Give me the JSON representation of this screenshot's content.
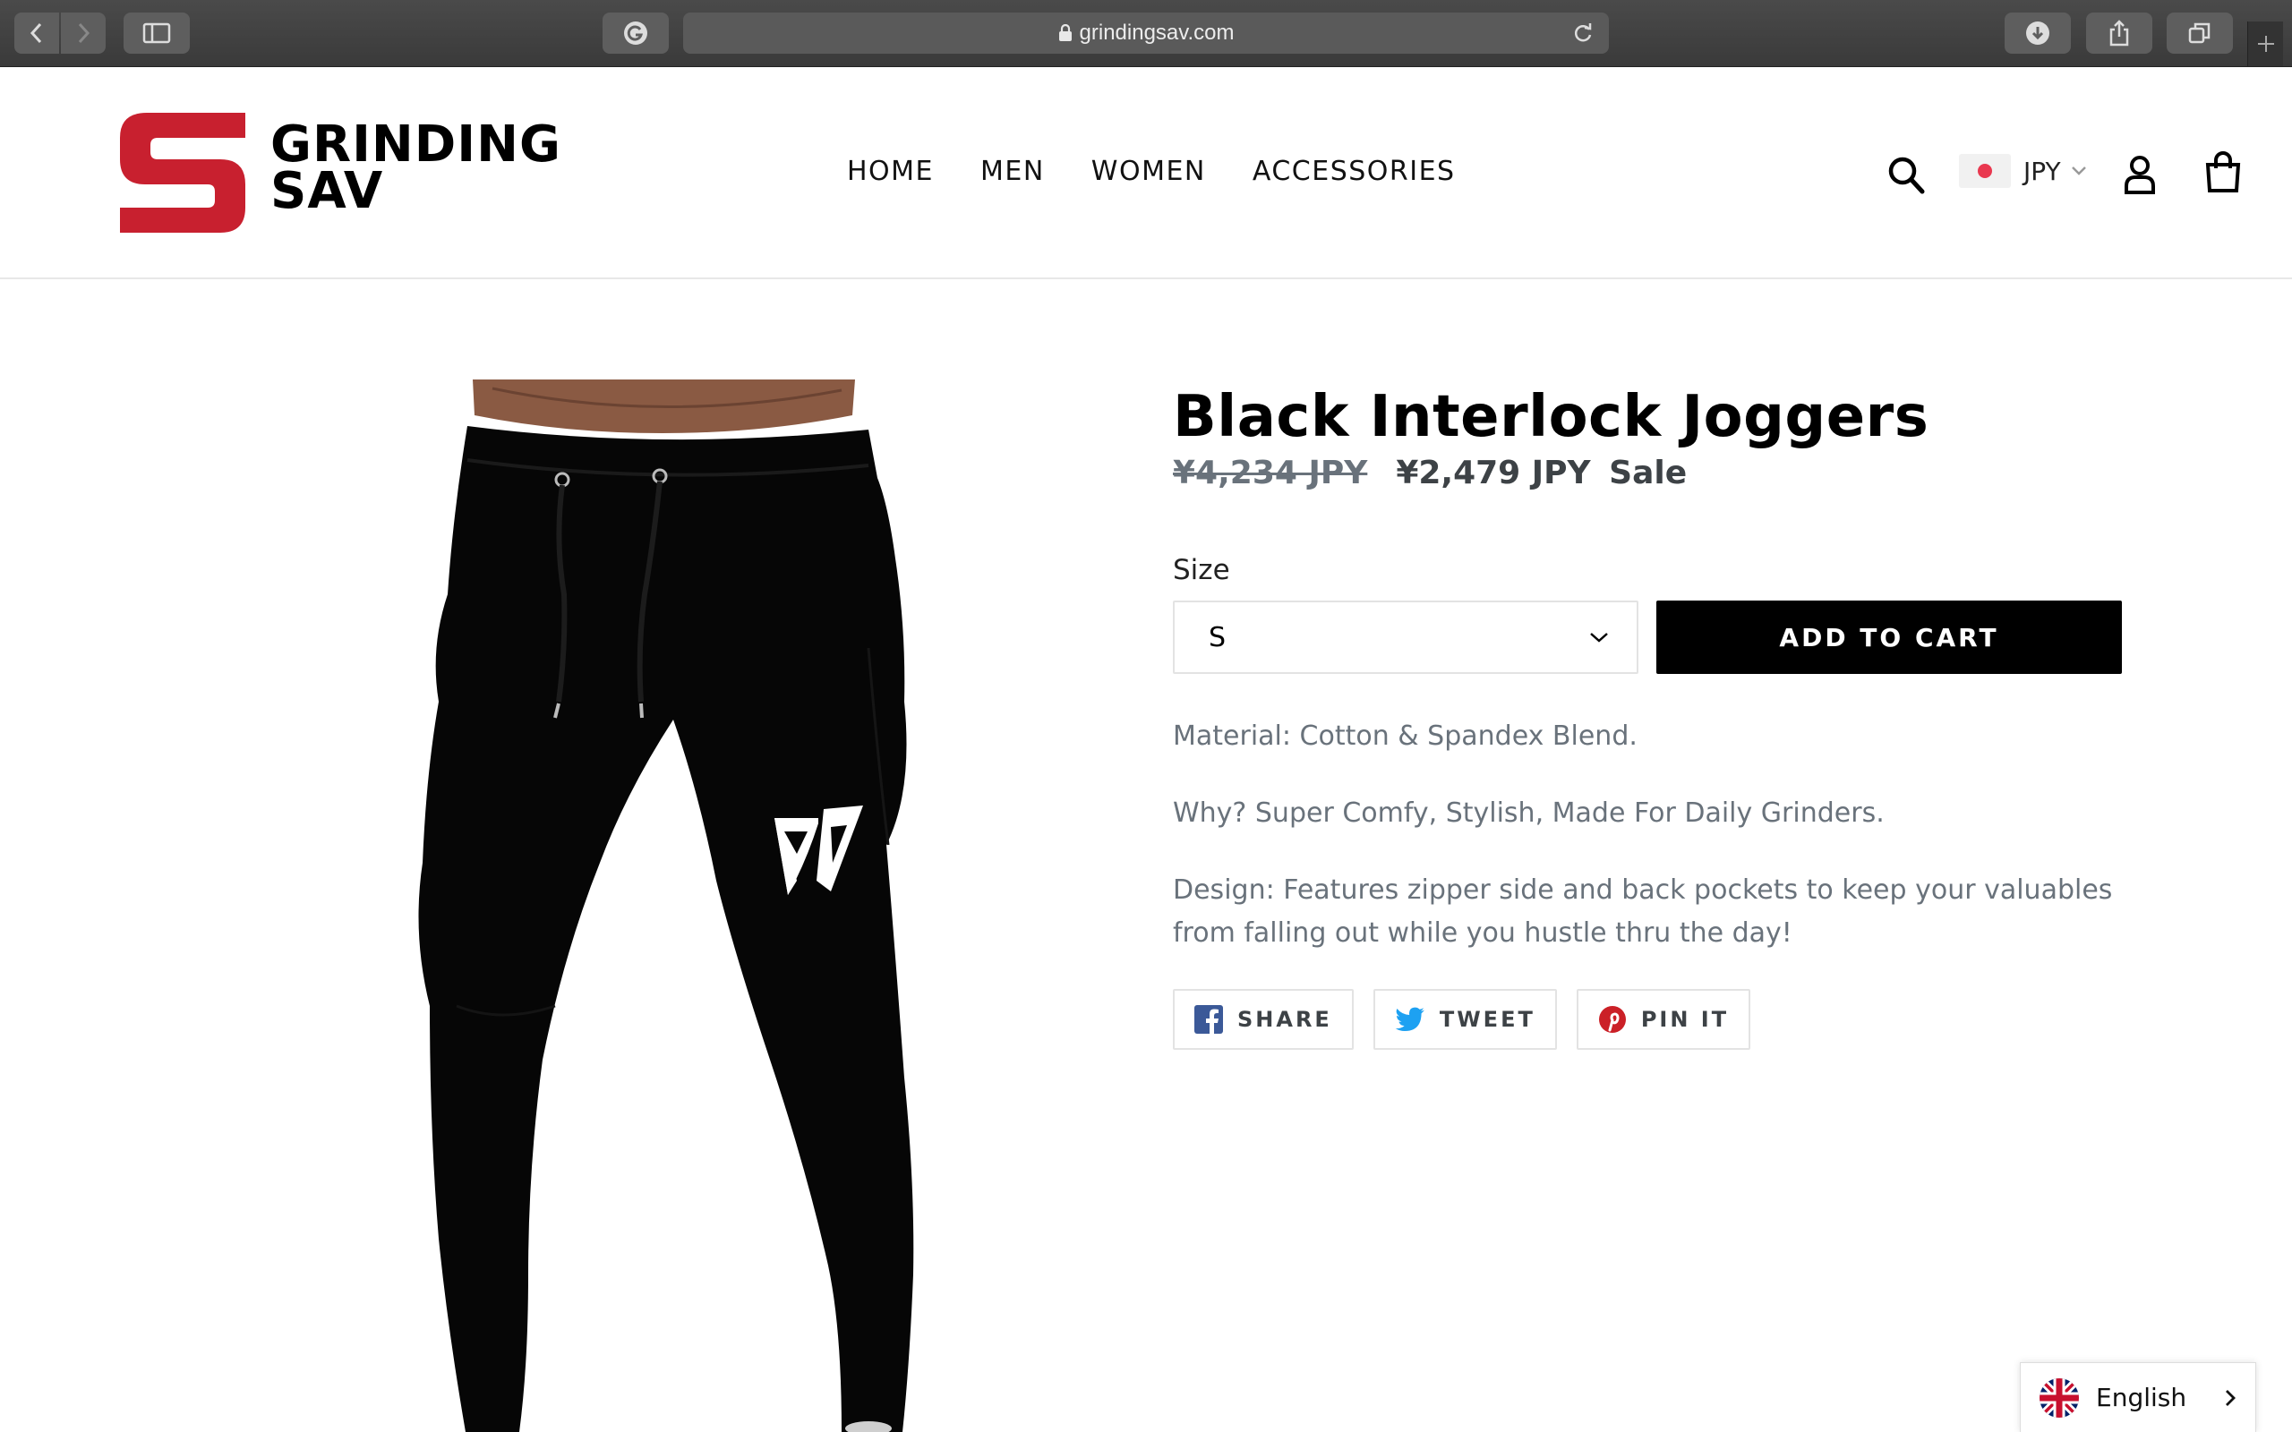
{
  "browser": {
    "url": "grindingsav.com"
  },
  "header": {
    "logo": {
      "line1": "GRINDING",
      "line2": "SAV",
      "accent": "#c8202f"
    },
    "nav": [
      "HOME",
      "MEN",
      "WOMEN",
      "ACCESSORIES"
    ],
    "currency": {
      "code": "JPY",
      "flag_color": "#e9384f"
    },
    "icons": [
      "search-icon",
      "account-icon",
      "cart-icon"
    ]
  },
  "product": {
    "title": "Black Interlock Joggers",
    "price_old": "¥4,234 JPY",
    "price_new": "¥2,479 JPY",
    "sale_label": "Sale",
    "size_label": "Size",
    "size_selected": "S",
    "add_to_cart": "ADD TO CART",
    "description": [
      "Material: Cotton & Spandex Blend.",
      "Why? Super Comfy, Stylish, Made For Daily Grinders.",
      "Design: Features zipper side and back pockets to keep your valuables from falling out while you hustle thru the day!"
    ],
    "share": {
      "facebook": "SHARE",
      "twitter": "TWEET",
      "pinterest": "PIN IT"
    }
  },
  "language_widget": {
    "label": "English"
  },
  "colors": {
    "facebook": "#3b5998",
    "twitter": "#1da1f2",
    "pinterest": "#cb2027",
    "muted_text": "#69727b"
  }
}
